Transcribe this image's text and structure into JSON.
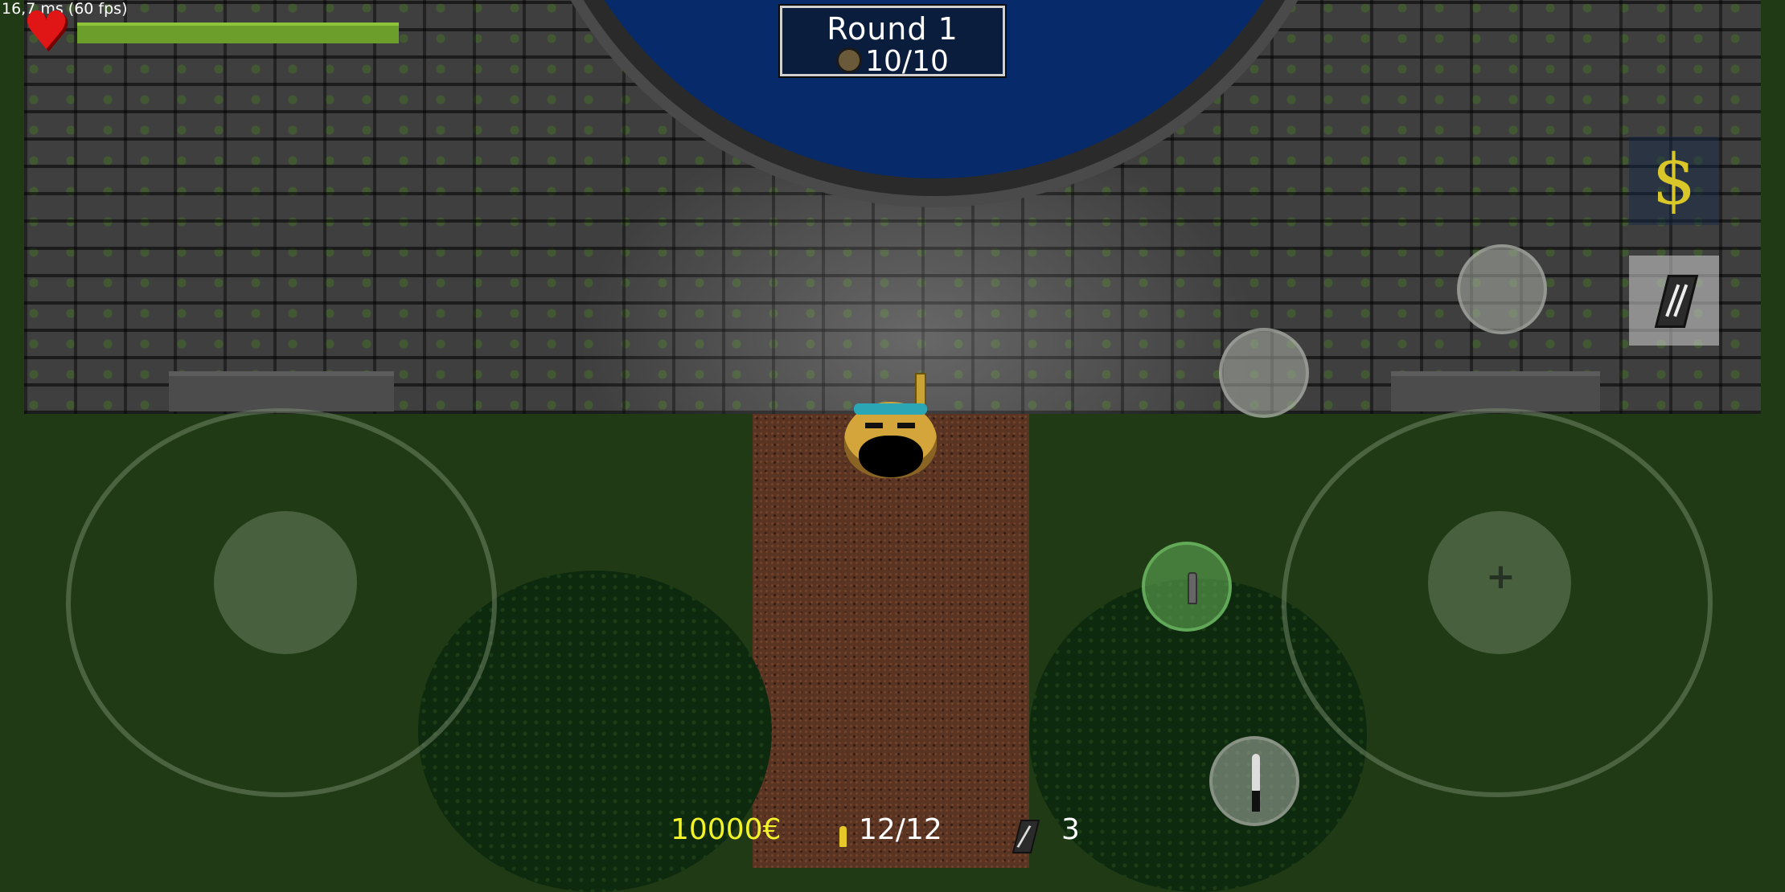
{
  "perf_text": "16,7 ms (60 fps)",
  "player": {
    "health_fraction": 1.0
  },
  "round": {
    "title": "Round 1",
    "enemies": "10/10"
  },
  "hud": {
    "money": "10000€",
    "ammo": "12/12",
    "magazines": "3"
  },
  "colors": {
    "money": "#f3f32a",
    "health": "#6b9e2a",
    "heart": "#e01515",
    "pool": "#062a6a",
    "shop_dollar": "#d9c72a"
  },
  "icons": {
    "shop": "dollar-icon",
    "reload": "magazine-icon",
    "melee": "knife-icon",
    "heart": "heart-icon",
    "enemy": "enemy-icon",
    "ammo": "bullet-icon"
  }
}
